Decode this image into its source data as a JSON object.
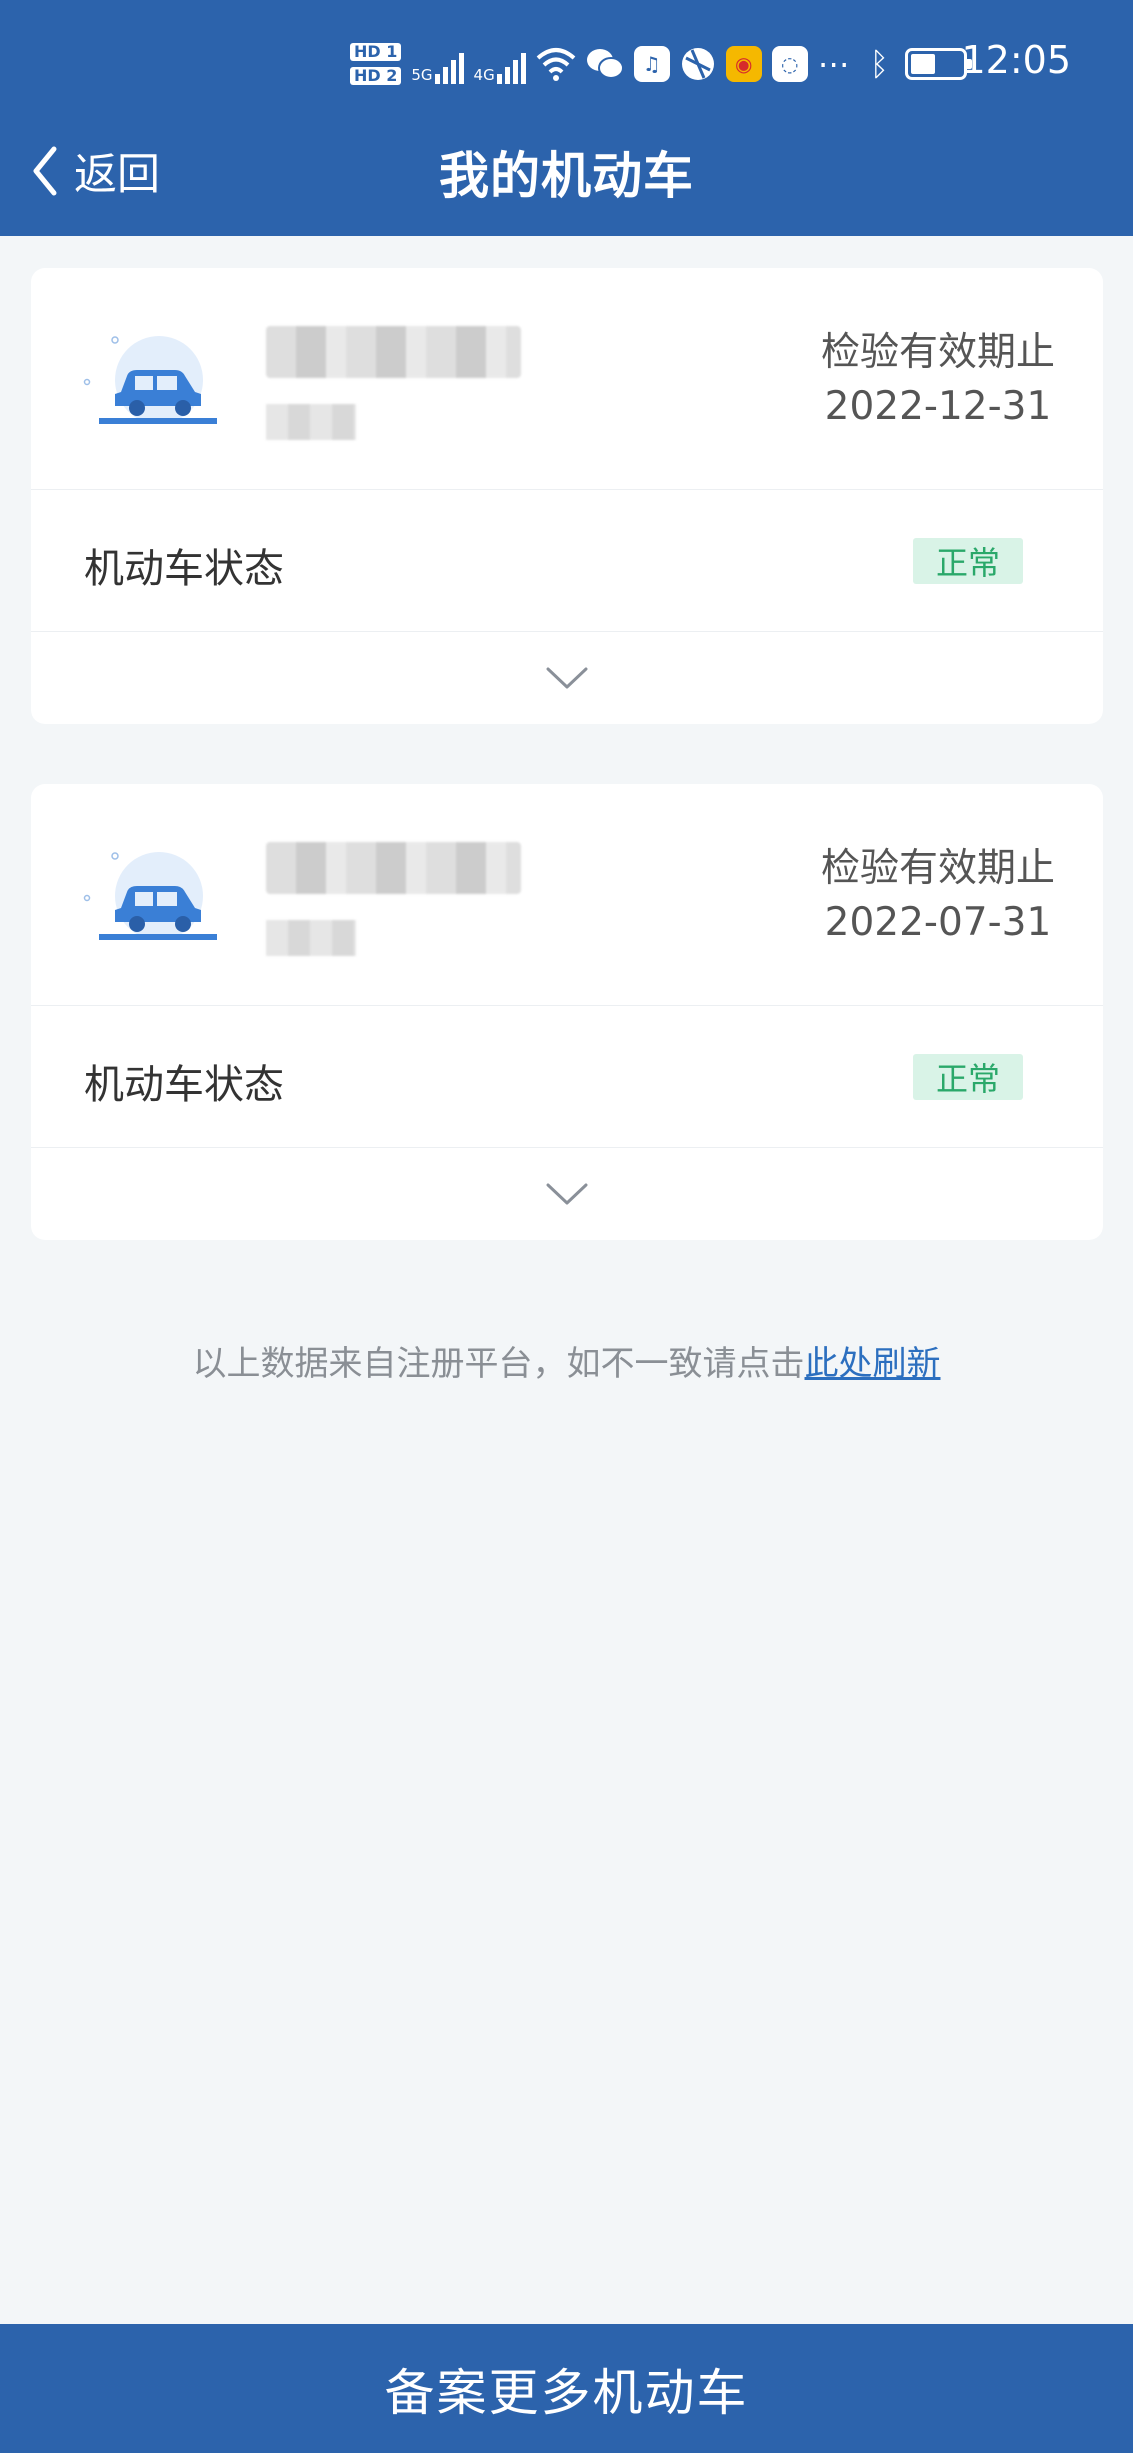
{
  "status_bar": {
    "hd1": "HD 1",
    "hd2": "HD 2",
    "net1": "5G",
    "net2": "4G",
    "time": "12:05",
    "icons": [
      "wifi-icon",
      "wechat-icon",
      "music-icon",
      "browser-icon",
      "weibo-icon",
      "chat-icon",
      "more-icon",
      "bluetooth-icon",
      "battery-icon"
    ]
  },
  "header": {
    "back_label": "返回",
    "title": "我的机动车"
  },
  "vehicles": [
    {
      "expiry_label": "检验有效期止",
      "expiry_date": "2022-12-31",
      "status_label": "机动车状态",
      "status_value": "正常"
    },
    {
      "expiry_label": "检验有效期止",
      "expiry_date": "2022-07-31",
      "status_label": "机动车状态",
      "status_value": "正常"
    }
  ],
  "footer_note": {
    "text": "以上数据来自注册平台，如不一致请点击",
    "link": "此处刷新"
  },
  "bottom_button": "备案更多机动车",
  "colors": {
    "brand": "#2c63ac",
    "status_ok_bg": "#d9f3e7",
    "status_ok_text": "#2aa86a",
    "link": "#2c6fbf"
  }
}
